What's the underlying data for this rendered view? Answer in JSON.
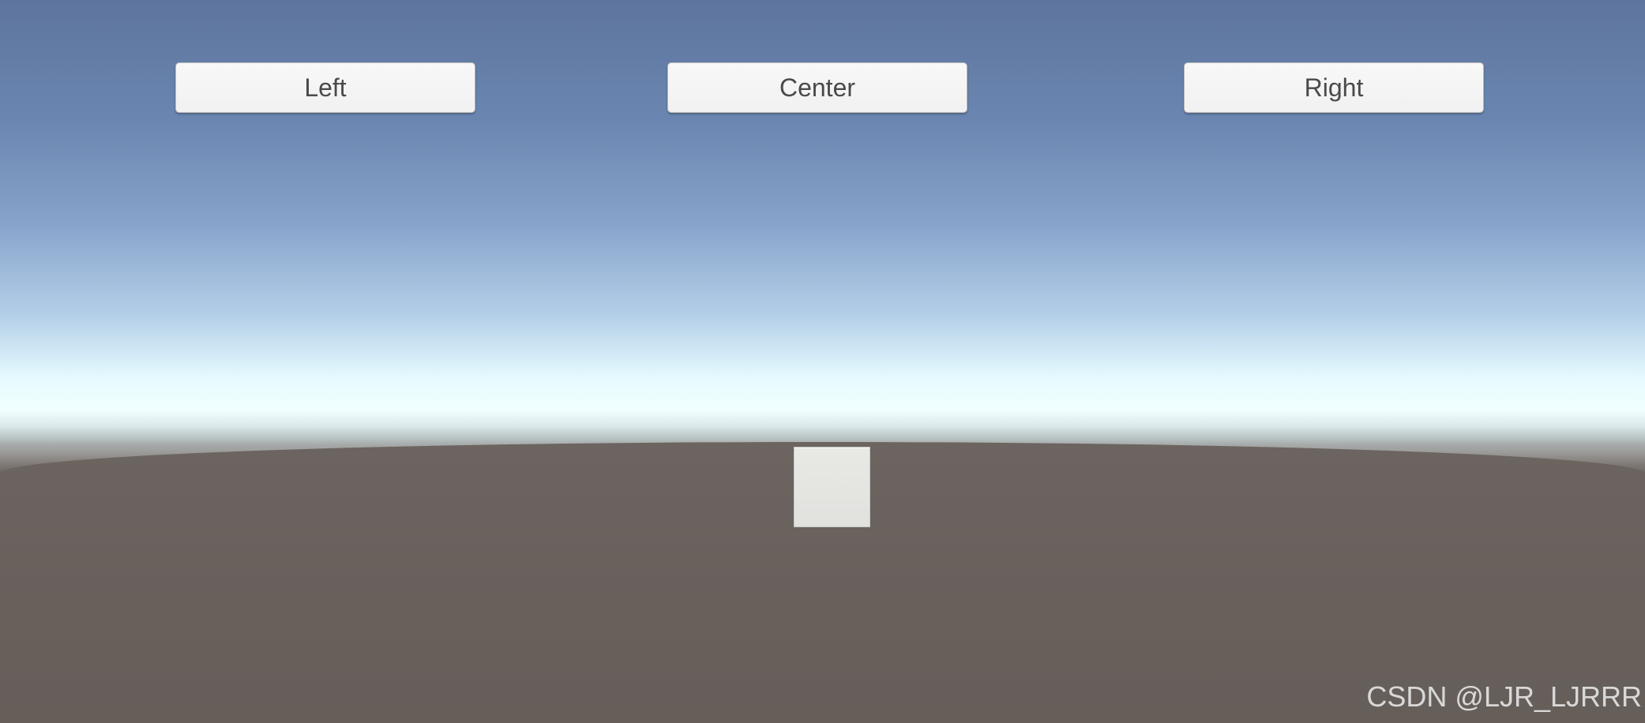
{
  "buttons": {
    "left_label": "Left",
    "center_label": "Center",
    "right_label": "Right"
  },
  "watermark": "CSDN @LJR_LJRRR",
  "colors": {
    "sky_top": "#5d749e",
    "horizon": "#f2ffff",
    "ground": "#68605b",
    "button_bg": "#f4f4f4",
    "button_text": "#4a4a4a",
    "cube": "#e4e4e1"
  }
}
